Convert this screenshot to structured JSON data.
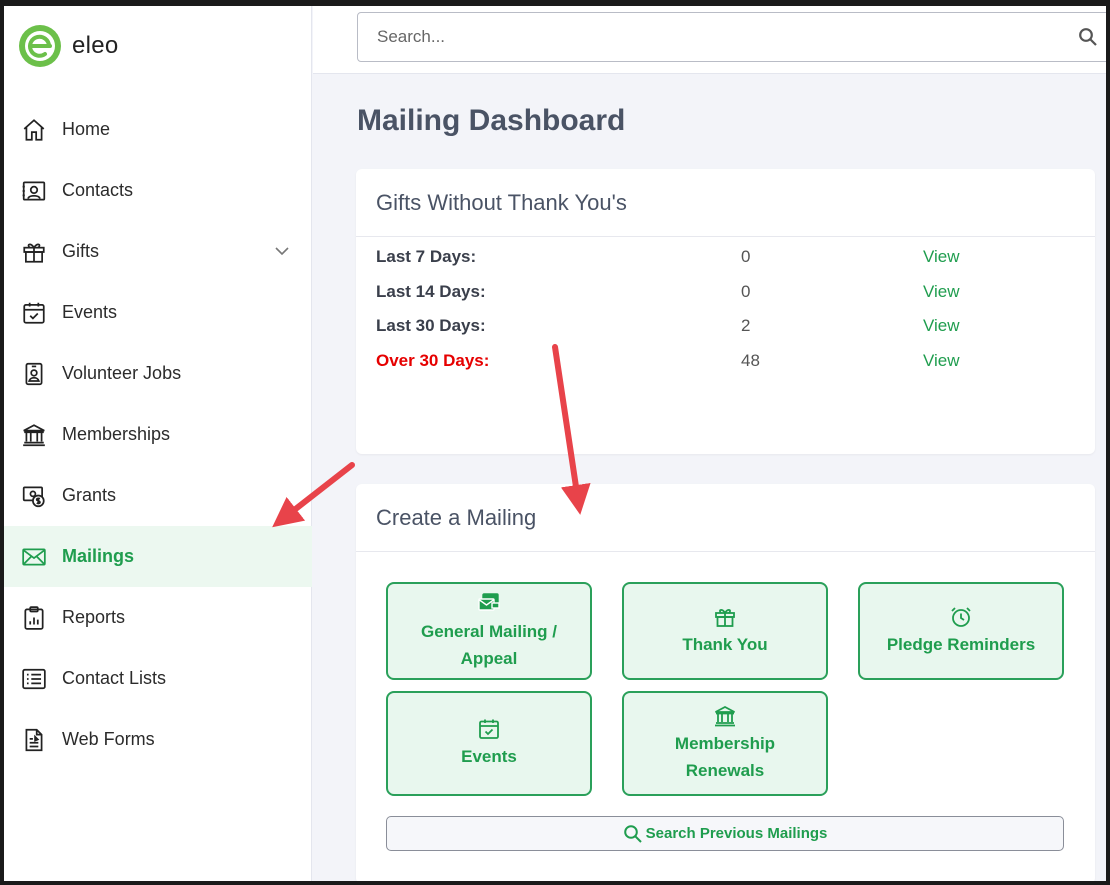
{
  "app": {
    "brand": "eleo",
    "accent": "#1f9d4e",
    "warning": "#e60000"
  },
  "search": {
    "placeholder": "Search..."
  },
  "sidebar": {
    "items": [
      {
        "label": "Home",
        "icon": "home-icon"
      },
      {
        "label": "Contacts",
        "icon": "contact-card-icon"
      },
      {
        "label": "Gifts",
        "icon": "gift-icon",
        "expandable": true
      },
      {
        "label": "Events",
        "icon": "calendar-icon"
      },
      {
        "label": "Volunteer Jobs",
        "icon": "badge-icon"
      },
      {
        "label": "Memberships",
        "icon": "bank-icon"
      },
      {
        "label": "Grants",
        "icon": "cash-icon"
      },
      {
        "label": "Mailings",
        "icon": "envelope-icon",
        "active": true
      },
      {
        "label": "Reports",
        "icon": "report-clipboard-icon"
      },
      {
        "label": "Contact Lists",
        "icon": "list-icon"
      },
      {
        "label": "Web Forms",
        "icon": "document-icon"
      }
    ]
  },
  "main": {
    "title": "Mailing Dashboard",
    "gifts_card": {
      "title": "Gifts Without Thank You's",
      "rows": [
        {
          "label": "Last 7 Days:",
          "count": "0",
          "action": "View"
        },
        {
          "label": "Last 14 Days:",
          "count": "0",
          "action": "View"
        },
        {
          "label": "Last 30 Days:",
          "count": "2",
          "action": "View"
        },
        {
          "label": "Over 30 Days:",
          "count": "48",
          "action": "View",
          "warning": true
        }
      ]
    },
    "mailing_card": {
      "title": "Create a Mailing",
      "tiles": [
        {
          "label": "General Mailing / Appeal",
          "icon": "mail-stack-icon"
        },
        {
          "label": "Thank You",
          "icon": "gift-icon"
        },
        {
          "label": "Pledge Reminders",
          "icon": "alarm-clock-icon"
        },
        {
          "label": "Events",
          "icon": "calendar-icon"
        },
        {
          "label": "Membership Renewals",
          "icon": "bank-icon"
        }
      ],
      "search_previous": "Search Previous Mailings"
    }
  }
}
